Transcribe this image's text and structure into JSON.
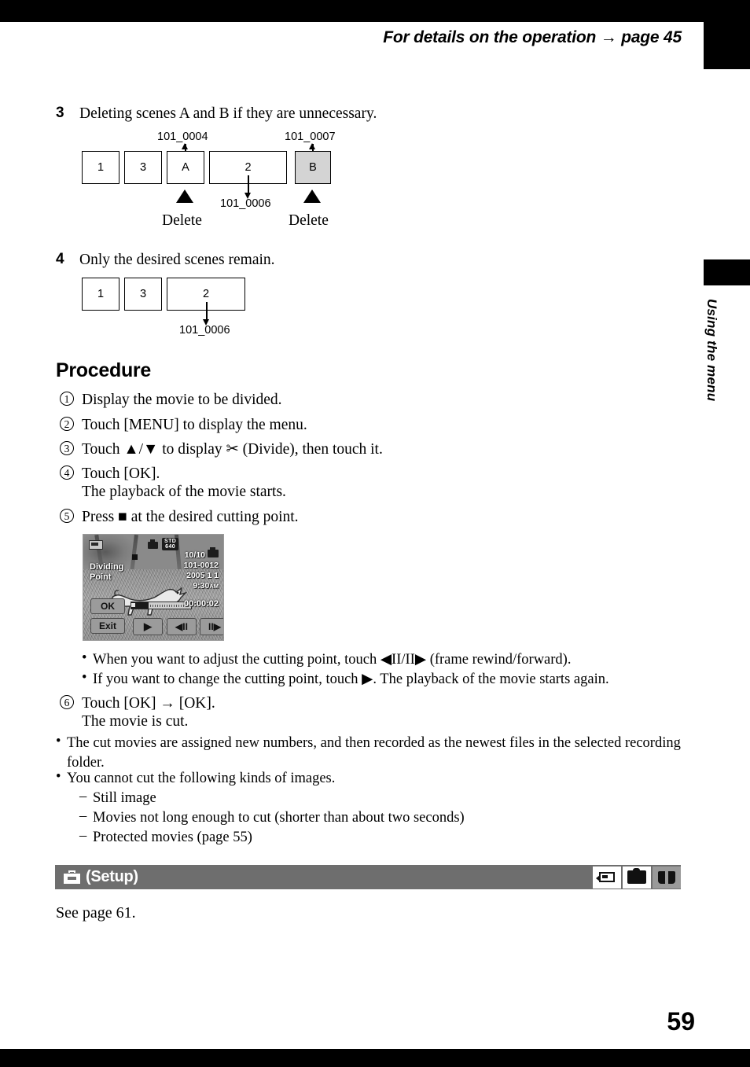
{
  "page": {
    "number": "59",
    "running_head": "For details on the operation → page 45",
    "side_tab_label": "Using the menu"
  },
  "steps": [
    {
      "number": "3",
      "text": "Deleting scenes A and B if they are unnecessary."
    },
    {
      "number": "4",
      "text": "Only the desired scenes remain."
    }
  ],
  "diagram_step3": {
    "boxes": [
      {
        "label": "1",
        "shaded": false
      },
      {
        "label": "3",
        "shaded": false
      },
      {
        "label": "A",
        "shaded": false
      },
      {
        "label": "2",
        "shaded": false
      },
      {
        "label": "B",
        "shaded": true
      }
    ],
    "file_labels": {
      "above_a": "101_0004",
      "above_b": "101_0007",
      "below_2": "101_0006"
    },
    "delete_captions": [
      "Delete",
      "Delete"
    ]
  },
  "diagram_step4": {
    "boxes": [
      {
        "label": "1"
      },
      {
        "label": "3"
      },
      {
        "label": "2"
      }
    ],
    "file_labels": {
      "below_2": "101_0006"
    }
  },
  "procedure": {
    "heading": "Procedure",
    "items": [
      {
        "num": "1",
        "text": "Display the movie to be divided."
      },
      {
        "num": "2",
        "text": "Touch [MENU] to display the menu."
      },
      {
        "num": "3",
        "text": "Touch ▲/▼ to display ✂ (Divide), then touch it."
      },
      {
        "num": "4",
        "text": "Touch [OK].",
        "sub": "The playback of the movie starts."
      },
      {
        "num": "5",
        "text": "Press ■ at the desired cutting point."
      },
      {
        "num": "6",
        "text": "Touch [OK] → [OK].",
        "sub": "The movie is cut."
      }
    ]
  },
  "lcd_screen": {
    "status_mode": "STD",
    "status_size": "640",
    "overlay_title_line1": "Dividing",
    "overlay_title_line2": "Point",
    "counter": "10/10",
    "file": "101-0012",
    "date": "2005  1   1",
    "time": "9:30",
    "am_pm": "AM",
    "elapsed": "00:00:02",
    "buttons": {
      "ok": "OK",
      "exit": "Exit",
      "play": "▶",
      "frame_rewind": "◀II",
      "frame_forward": "II▶"
    }
  },
  "screen_notes": [
    "When you want to adjust the cutting point, touch ◀II/II▶ (frame rewind/forward).",
    "If you want to change the cutting point, touch ▶. The playback of the movie starts again."
  ],
  "notes": [
    "The cut movies are assigned new numbers, and then recorded as the newest files in the selected recording folder.",
    "You cannot cut the following kinds of images."
  ],
  "sub_notes": [
    "Still image",
    "Movies not long enough to cut (shorter than about two seconds)",
    "Protected movies (page 55)"
  ],
  "setup_band": {
    "label": "(Setup)",
    "icon": "toolbox-icon",
    "mode_icons": [
      "movie-mode-icon",
      "camera-mode-icon",
      "playback-mode-icon"
    ],
    "active_mode_index": 2
  },
  "footer": {
    "see_page": "See page 61."
  }
}
